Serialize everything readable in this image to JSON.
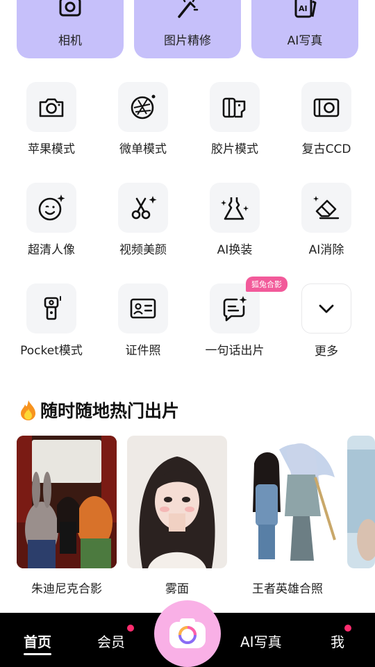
{
  "top_cards": [
    {
      "label": "相机",
      "icon": "camera-icon"
    },
    {
      "label": "图片精修",
      "icon": "magic-wand-icon"
    },
    {
      "label": "AI写真",
      "icon": "ai-portrait-icon"
    }
  ],
  "tools": [
    {
      "label": "苹果模式",
      "icon": "camera-outline-icon"
    },
    {
      "label": "微单模式",
      "icon": "aperture-icon"
    },
    {
      "label": "胶片模式",
      "icon": "film-roll-icon"
    },
    {
      "label": "复古CCD",
      "icon": "ccd-camera-icon"
    },
    {
      "label": "超清人像",
      "icon": "face-sparkle-icon"
    },
    {
      "label": "视频美颜",
      "icon": "scissors-icon"
    },
    {
      "label": "AI换装",
      "icon": "dress-icon"
    },
    {
      "label": "AI消除",
      "icon": "eraser-icon"
    },
    {
      "label": "Pocket模式",
      "icon": "pocket-camera-icon"
    },
    {
      "label": "证件照",
      "icon": "id-card-icon"
    },
    {
      "label": "一句话出片",
      "icon": "chat-sparkle-icon",
      "badge": "狐兔合影"
    },
    {
      "label": "更多",
      "icon": "chevron-down-icon"
    }
  ],
  "section": {
    "title": "随时随地热门出片",
    "icon": "fire-icon"
  },
  "photos": [
    {
      "caption": "朱迪尼克合影"
    },
    {
      "caption": "雾面"
    },
    {
      "caption": "王者英雄合照"
    },
    {
      "caption": ""
    }
  ],
  "tabbar": {
    "home": "首页",
    "member": "会员",
    "ai": "AI写真",
    "me": "我"
  },
  "colors": {
    "card_purple": "#c6c0fa",
    "tile_bg": "#f4f5f7",
    "badge_pink": "#f25a9a",
    "camera_pink": "#f9b0e6",
    "dot_red": "#ff2d6f"
  }
}
